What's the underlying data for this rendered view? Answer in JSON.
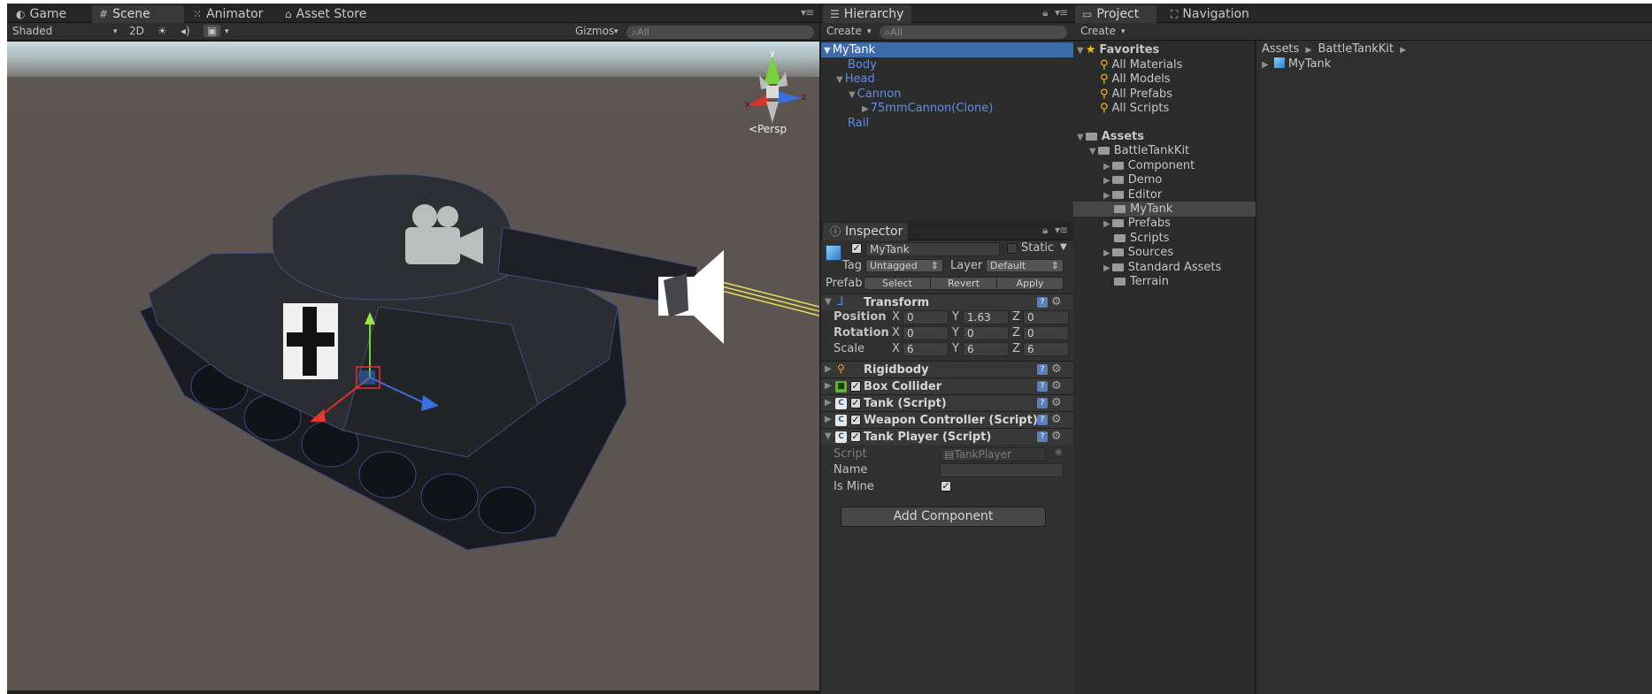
{
  "scene_panel": {
    "tabs": [
      {
        "icon": "game-icon",
        "label": "Game"
      },
      {
        "icon": "scene-icon",
        "label": "Scene"
      },
      {
        "icon": "animator-icon",
        "label": "Animator"
      },
      {
        "icon": "asset-store-icon",
        "label": "Asset Store"
      }
    ],
    "toolbar": {
      "draw_mode": "Shaded",
      "mode_2d": "2D",
      "gizmos": "Gizmos",
      "search_placeholder": "All"
    },
    "gizmo": {
      "y": "y",
      "x": "x",
      "z": "z",
      "projection": "Persp"
    }
  },
  "hierarchy": {
    "tab": "Hierarchy",
    "create": "Create",
    "search_placeholder": "All",
    "items": [
      {
        "label": "MyTank",
        "expanded": true
      },
      {
        "label": "Body"
      },
      {
        "label": "Head",
        "expanded": true
      },
      {
        "label": "Cannon",
        "expanded": true
      },
      {
        "label": "75mmCannon(Clone)",
        "expanded": false
      },
      {
        "label": "Rail"
      }
    ]
  },
  "inspector": {
    "tab": "Inspector",
    "object_name": "MyTank",
    "static_label": "Static",
    "tag_label": "Tag",
    "tag_value": "Untagged",
    "layer_label": "Layer",
    "layer_value": "Default",
    "prefab_label": "Prefab",
    "prefab_select": "Select",
    "prefab_revert": "Revert",
    "prefab_apply": "Apply",
    "transform": {
      "title": "Transform",
      "position_label": "Position",
      "rotation_label": "Rotation",
      "scale_label": "Scale",
      "axis_x": "X",
      "axis_y": "Y",
      "axis_z": "Z",
      "position": {
        "x": "0",
        "y": "1.63",
        "z": "0"
      },
      "rotation": {
        "x": "0",
        "y": "0",
        "z": "0"
      },
      "scale": {
        "x": "6",
        "y": "6",
        "z": "6"
      }
    },
    "components": [
      {
        "title": "Rigidbody"
      },
      {
        "title": "Box Collider"
      },
      {
        "title": "Tank (Script)"
      },
      {
        "title": "Weapon Controller (Script)"
      },
      {
        "title": "Tank Player (Script)"
      }
    ],
    "tank_player": {
      "script_label": "Script",
      "script_value": "TankPlayer",
      "name_label": "Name",
      "name_value": "",
      "is_mine_label": "Is Mine",
      "is_mine": true
    },
    "add_component": "Add Component"
  },
  "project": {
    "tab": "Project",
    "nav_tab": "Navigation",
    "create": "Create",
    "breadcrumb": [
      "Assets",
      "BattleTankKit"
    ],
    "favorites_label": "Favorites",
    "favorites": [
      "All Materials",
      "All Models",
      "All Prefabs",
      "All Scripts"
    ],
    "assets_label": "Assets",
    "tree": [
      {
        "label": "BattleTankKit"
      },
      {
        "label": "Component"
      },
      {
        "label": "Demo"
      },
      {
        "label": "Editor"
      },
      {
        "label": "MyTank"
      },
      {
        "label": "Prefabs"
      },
      {
        "label": "Scripts"
      },
      {
        "label": "Sources"
      },
      {
        "label": "Standard Assets"
      },
      {
        "label": "Terrain"
      }
    ],
    "contents": [
      {
        "label": "MyTank"
      }
    ]
  },
  "colors": {
    "selection": "#3d6aa8",
    "hierarchy_link": "#5e8ee6",
    "favorites_star": "#f2c200",
    "gizmo_x": "#d8332a",
    "gizmo_y": "#7ad23a",
    "gizmo_z": "#3a6fe0"
  }
}
